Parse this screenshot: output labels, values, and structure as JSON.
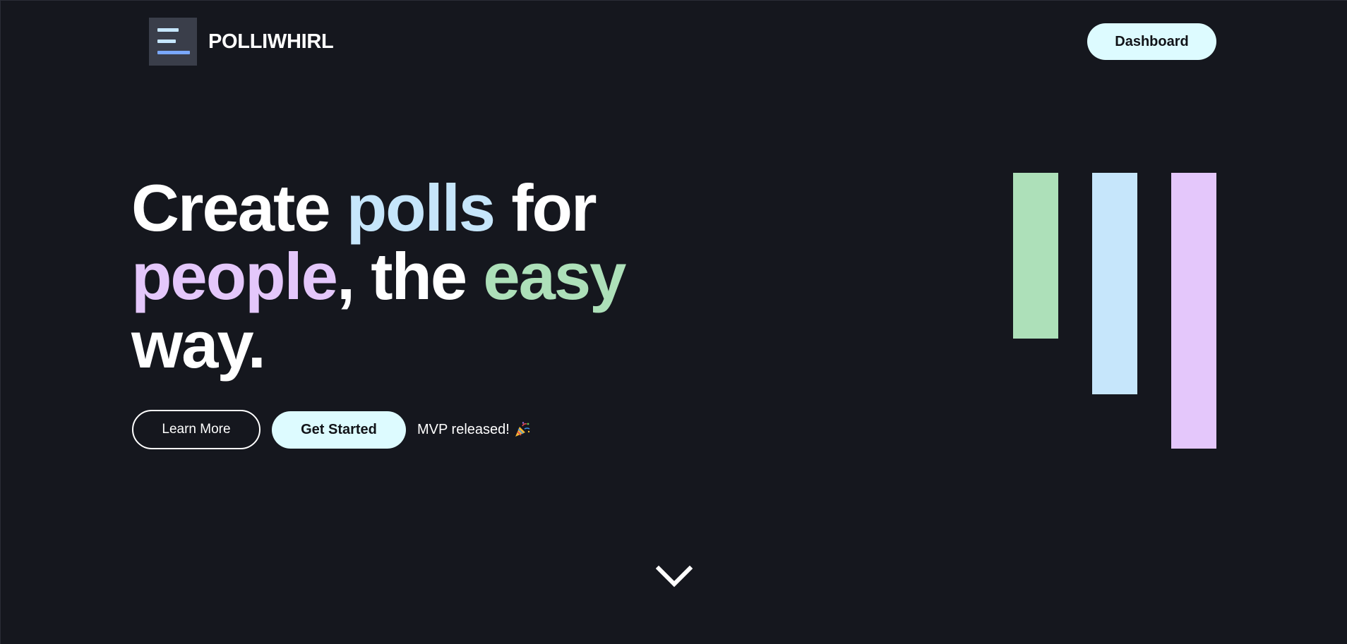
{
  "header": {
    "brand": "POLLIWHIRL",
    "dashboard_label": "Dashboard",
    "logo_icon": "menu-lines-logo-icon"
  },
  "hero": {
    "line1": {
      "w1": "Create",
      "w2": "polls",
      "w3": "for"
    },
    "line2": {
      "w1": "people",
      "w2": ",",
      "w3": "the",
      "w4": "easy"
    },
    "line3": {
      "w1": "way."
    }
  },
  "cta": {
    "learn_more": "Learn More",
    "get_started": "Get Started",
    "status_text": "MVP released!",
    "status_icon": "party-popper-icon"
  },
  "scroll_icon": "chevron-down-icon",
  "colors": {
    "background": "#15171e",
    "accent_blue": "#c6e6fb",
    "accent_purple": "#e4c7fb",
    "accent_green": "#ade0b9",
    "button_bg": "#ddfbff"
  }
}
